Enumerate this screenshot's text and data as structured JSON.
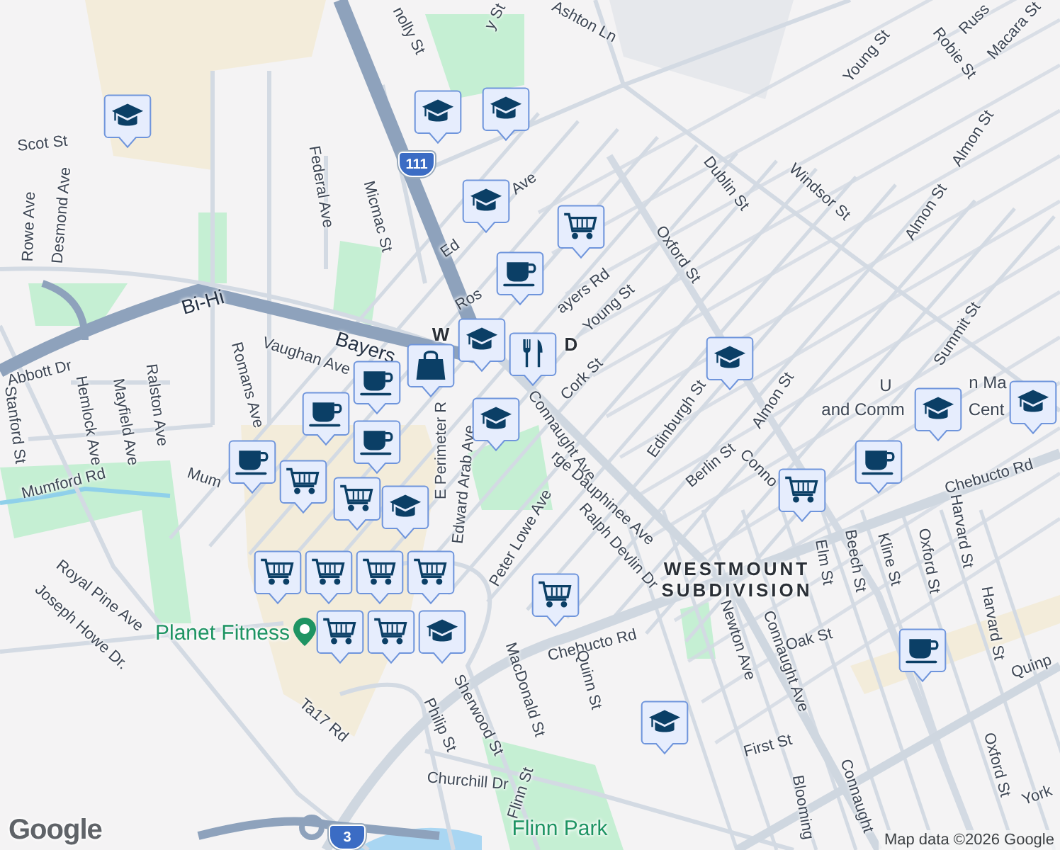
{
  "map": {
    "labels": [
      {
        "text": "Ashton Ln",
        "kind": "street"
      },
      {
        "text": "nolly St",
        "kind": "street"
      },
      {
        "text": "y St",
        "kind": "street"
      },
      {
        "text": "Young St",
        "kind": "street"
      },
      {
        "text": "Russ",
        "kind": "street"
      },
      {
        "text": "Robie St",
        "kind": "street"
      },
      {
        "text": "Macara St",
        "kind": "street"
      },
      {
        "text": "Scot St",
        "kind": "street"
      },
      {
        "text": "Rowe Ave",
        "kind": "street"
      },
      {
        "text": "Desmond Ave",
        "kind": "street"
      },
      {
        "text": "Federal Ave",
        "kind": "street"
      },
      {
        "text": "Micmac St",
        "kind": "street"
      },
      {
        "text": "Dublin St",
        "kind": "street"
      },
      {
        "text": "Windsor St",
        "kind": "street"
      },
      {
        "text": "Almon St",
        "kind": "street"
      },
      {
        "text": "Almon St",
        "kind": "street"
      },
      {
        "text": "Oxford St",
        "kind": "street"
      },
      {
        "text": "Ed",
        "kind": "street"
      },
      {
        "text": "Ave",
        "kind": "street"
      },
      {
        "text": "Bi-Hi",
        "kind": "highway"
      },
      {
        "text": "Bayers",
        "kind": "highway"
      },
      {
        "text": "ayers Rd",
        "kind": "street"
      },
      {
        "text": "Ros",
        "kind": "street"
      },
      {
        "text": "Young St",
        "kind": "street"
      },
      {
        "text": "Cork St",
        "kind": "street"
      },
      {
        "text": "Vaughan Ave",
        "kind": "street"
      },
      {
        "text": "Romans Ave",
        "kind": "street"
      },
      {
        "text": "Abbott Dr",
        "kind": "street"
      },
      {
        "text": "Stanford St",
        "kind": "street"
      },
      {
        "text": "Hemlock Ave",
        "kind": "street"
      },
      {
        "text": "Mayfield Ave",
        "kind": "street"
      },
      {
        "text": "Ralston Ave",
        "kind": "street"
      },
      {
        "text": "W",
        "kind": "district"
      },
      {
        "text": "D",
        "kind": "district"
      },
      {
        "text": "Connaught Ave",
        "kind": "street"
      },
      {
        "text": "rge Dauphinee Ave",
        "kind": "street"
      },
      {
        "text": "Edinburgh St",
        "kind": "street"
      },
      {
        "text": "Almon St",
        "kind": "street"
      },
      {
        "text": "Summit St",
        "kind": "street"
      },
      {
        "text": "U",
        "kind": "place"
      },
      {
        "text": "n Ma",
        "kind": "place"
      },
      {
        "text": "and Comm",
        "kind": "place"
      },
      {
        "text": "Cent",
        "kind": "place"
      },
      {
        "text": "Berlin St",
        "kind": "street"
      },
      {
        "text": "Conno",
        "kind": "street"
      },
      {
        "text": "Chebucto Rd",
        "kind": "street"
      },
      {
        "text": "E Perimeter R",
        "kind": "street"
      },
      {
        "text": "Edward Arab Ave",
        "kind": "street"
      },
      {
        "text": "Mumford Rd",
        "kind": "street"
      },
      {
        "text": "Mum",
        "kind": "street"
      },
      {
        "text": "Peter Lowe Ave",
        "kind": "street"
      },
      {
        "text": "Ralph Devlin Dr",
        "kind": "street"
      },
      {
        "text": "WESTMOUNT\nSUBDIVISION",
        "kind": "district"
      },
      {
        "text": "Elm St",
        "kind": "street"
      },
      {
        "text": "Beech St",
        "kind": "street"
      },
      {
        "text": "Kline St",
        "kind": "street"
      },
      {
        "text": "Oxford St",
        "kind": "street"
      },
      {
        "text": "Harvard St",
        "kind": "street"
      },
      {
        "text": "Harvard St",
        "kind": "street"
      },
      {
        "text": "Chebucto Rd",
        "kind": "street"
      },
      {
        "text": "Oak St",
        "kind": "street"
      },
      {
        "text": "Newton Ave",
        "kind": "street"
      },
      {
        "text": "Connaught Ave",
        "kind": "street"
      },
      {
        "text": "Quinn St",
        "kind": "street"
      },
      {
        "text": "Quinp",
        "kind": "street"
      },
      {
        "text": "Oxford St",
        "kind": "street"
      },
      {
        "text": "First St",
        "kind": "street"
      },
      {
        "text": "York",
        "kind": "street"
      },
      {
        "text": "Blooming",
        "kind": "street"
      },
      {
        "text": "Connaught",
        "kind": "street"
      },
      {
        "text": "Joseph Howe Dr.",
        "kind": "street"
      },
      {
        "text": "Royal Pine Ave",
        "kind": "street"
      },
      {
        "text": "Planet Fitness",
        "kind": "poi"
      },
      {
        "text": "Ta17 Rd",
        "kind": "street"
      },
      {
        "text": "Philip St",
        "kind": "street"
      },
      {
        "text": "Sherwood St",
        "kind": "street"
      },
      {
        "text": "MacDonald St",
        "kind": "street"
      },
      {
        "text": "Churchill Dr",
        "kind": "street"
      },
      {
        "text": "Flinn St",
        "kind": "street"
      },
      {
        "text": "Flinn Park",
        "kind": "park"
      }
    ],
    "shields": [
      "111",
      "3"
    ],
    "markers": [
      {
        "kind": "school"
      },
      {
        "kind": "school"
      },
      {
        "kind": "school"
      },
      {
        "kind": "school"
      },
      {
        "kind": "cart"
      },
      {
        "kind": "cup"
      },
      {
        "kind": "school"
      },
      {
        "kind": "bag"
      },
      {
        "kind": "cup"
      },
      {
        "kind": "cup"
      },
      {
        "kind": "cup"
      },
      {
        "kind": "school"
      },
      {
        "kind": "restaurant"
      },
      {
        "kind": "school"
      },
      {
        "kind": "school"
      },
      {
        "kind": "school"
      },
      {
        "kind": "school"
      },
      {
        "kind": "cup"
      },
      {
        "kind": "cart"
      },
      {
        "kind": "cart"
      },
      {
        "kind": "school"
      },
      {
        "kind": "cart"
      },
      {
        "kind": "cart"
      },
      {
        "kind": "cart"
      },
      {
        "kind": "cart"
      },
      {
        "kind": "cart"
      },
      {
        "kind": "cart"
      },
      {
        "kind": "cart"
      },
      {
        "kind": "cup"
      },
      {
        "kind": "cart"
      },
      {
        "kind": "cup"
      },
      {
        "kind": "school"
      }
    ],
    "logo": "Google",
    "attribution": "Map data ©2026 Google"
  }
}
